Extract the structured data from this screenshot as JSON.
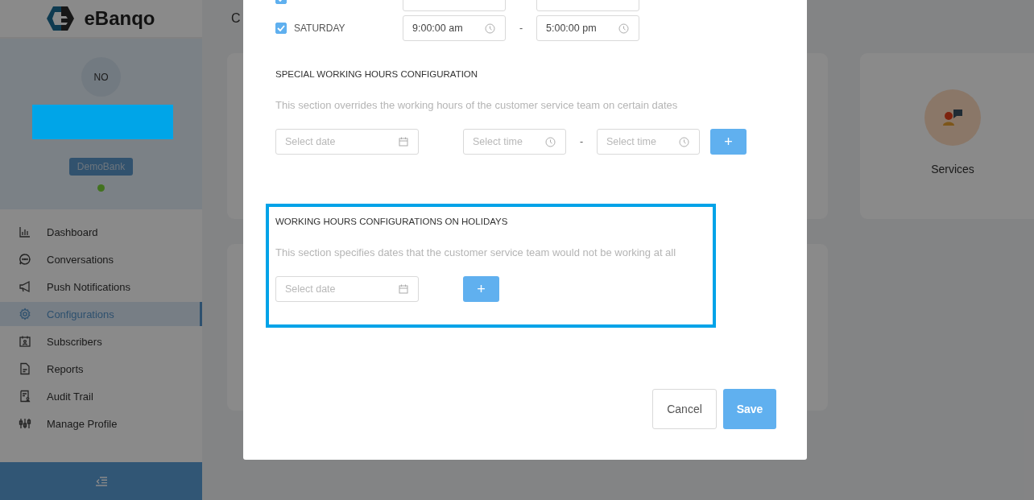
{
  "sidebar": {
    "logo": "eBanqo",
    "avatar": "NO",
    "name_redacted": true,
    "organization": "DemoBank",
    "online": true,
    "items": [
      {
        "label": "Dashboard",
        "selected": false
      },
      {
        "label": "Conversations",
        "selected": false
      },
      {
        "label": "Push Notifications",
        "selected": false
      },
      {
        "label": "Configurations",
        "selected": true
      },
      {
        "label": "Subscribers",
        "selected": false
      },
      {
        "label": "Reports",
        "selected": false
      },
      {
        "label": "Audit Trail",
        "selected": false
      },
      {
        "label": "Manage Profile",
        "selected": false
      }
    ]
  },
  "main": {
    "page_title": "C",
    "service_card": {
      "label": "Services"
    }
  },
  "modal": {
    "day_rows": [
      {
        "checked": true
      },
      {
        "checked": true,
        "label": "SATURDAY",
        "start": "9:00:00 am",
        "end": "5:00:00 pm",
        "separator": "-"
      }
    ],
    "special": {
      "heading": "SPECIAL WORKING HOURS CONFIGURATION",
      "description": "This section overrides the working hours of the customer service team on certain dates",
      "date_placeholder": "Select date",
      "start_placeholder": "Select time",
      "end_placeholder": "Select time",
      "separator": "-",
      "add_label": "+"
    },
    "holidays": {
      "heading": "WORKING HOURS CONFIGURATIONS ON HOLIDAYS",
      "description": "This section specifies dates that the customer service team would not be working at all",
      "date_placeholder": "Select date",
      "add_label": "+",
      "highlighted": true
    },
    "buttons": [
      {
        "label": "Cancel",
        "kind": "secondary"
      },
      {
        "label": "Save",
        "kind": "primary"
      }
    ]
  }
}
